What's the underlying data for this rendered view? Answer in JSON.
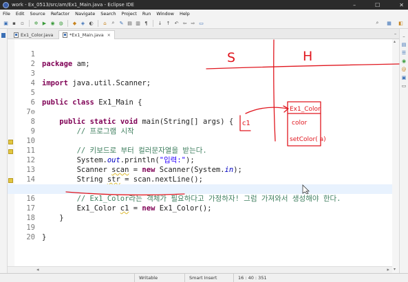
{
  "window": {
    "title": "work - Ex_0513/src/am/Ex1_Main.java - Eclipse IDE"
  },
  "menu": [
    "File",
    "Edit",
    "Source",
    "Refactor",
    "Navigate",
    "Search",
    "Project",
    "Run",
    "Window",
    "Help"
  ],
  "tabs": [
    {
      "label": "Ex1_Color.java",
      "active": false
    },
    {
      "label": "*Ex1_Main.java",
      "active": true
    }
  ],
  "editor": {
    "lines": [
      {
        "n": "1"
      },
      {
        "n": "2"
      },
      {
        "n": "3"
      },
      {
        "n": "4"
      },
      {
        "n": "5"
      },
      {
        "n": "6"
      },
      {
        "n": "7⊖"
      },
      {
        "n": "8"
      },
      {
        "n": "9"
      },
      {
        "n": "10"
      },
      {
        "n": "11"
      },
      {
        "n": "12"
      },
      {
        "n": "13"
      },
      {
        "n": "14"
      },
      {
        "n": "15"
      },
      {
        "n": "16"
      },
      {
        "n": "17"
      },
      {
        "n": "18"
      },
      {
        "n": "19"
      },
      {
        "n": "20"
      }
    ],
    "tokens": {
      "l1_kw": "package",
      "l1_rest": " am;",
      "l3_kw": "import",
      "l3_rest": " java.util.Scanner;",
      "l5_kw1": "public",
      "l5_kw2": "class",
      "l5_rest": " Ex1_Main {",
      "l7_indent": "    ",
      "l7_kw1": "public",
      "l7_kw2": "static",
      "l7_kw3": "void",
      "l7_rest": " main(String[] args) {",
      "l8_cm": "        // 프로그램 시작",
      "l10_cm": "        // 키보드로 부터 컬러문자열을 받는다.",
      "l11_a": "        System.",
      "l11_fld": "out",
      "l11_b": ".println(",
      "l11_str": "\"입력:\"",
      "l11_c": ");",
      "l12_a": "        Scanner ",
      "l12_var": "scan",
      "l12_b": " = ",
      "l12_kw": "new",
      "l12_c": " Scanner(System.",
      "l12_fld": "in",
      "l12_d": ");",
      "l13_a": "        String ",
      "l13_var": "str",
      "l13_b": " = scan.nextLine();",
      "l15_cm": "        // Ex1_Color라는 객체가 필요하다고 가정하자! 그럼 가져와서 생성해야 한다.",
      "l16_a": "        Ex1_Color ",
      "l16_var": "c1",
      "l16_b": " = ",
      "l16_kw": "new",
      "l16_c": " Ex1_Color();",
      "l17": "    }",
      "l19": "}"
    }
  },
  "annotations": {
    "S": "S",
    "H": "H",
    "c1": "c1",
    "box_title": "Ex1_Color",
    "color": "color",
    "setcolor": "setColor(  a)"
  },
  "status": {
    "writable": "Writable",
    "insert_mode": "Smart Insert",
    "position": "16 : 40 : 351"
  }
}
